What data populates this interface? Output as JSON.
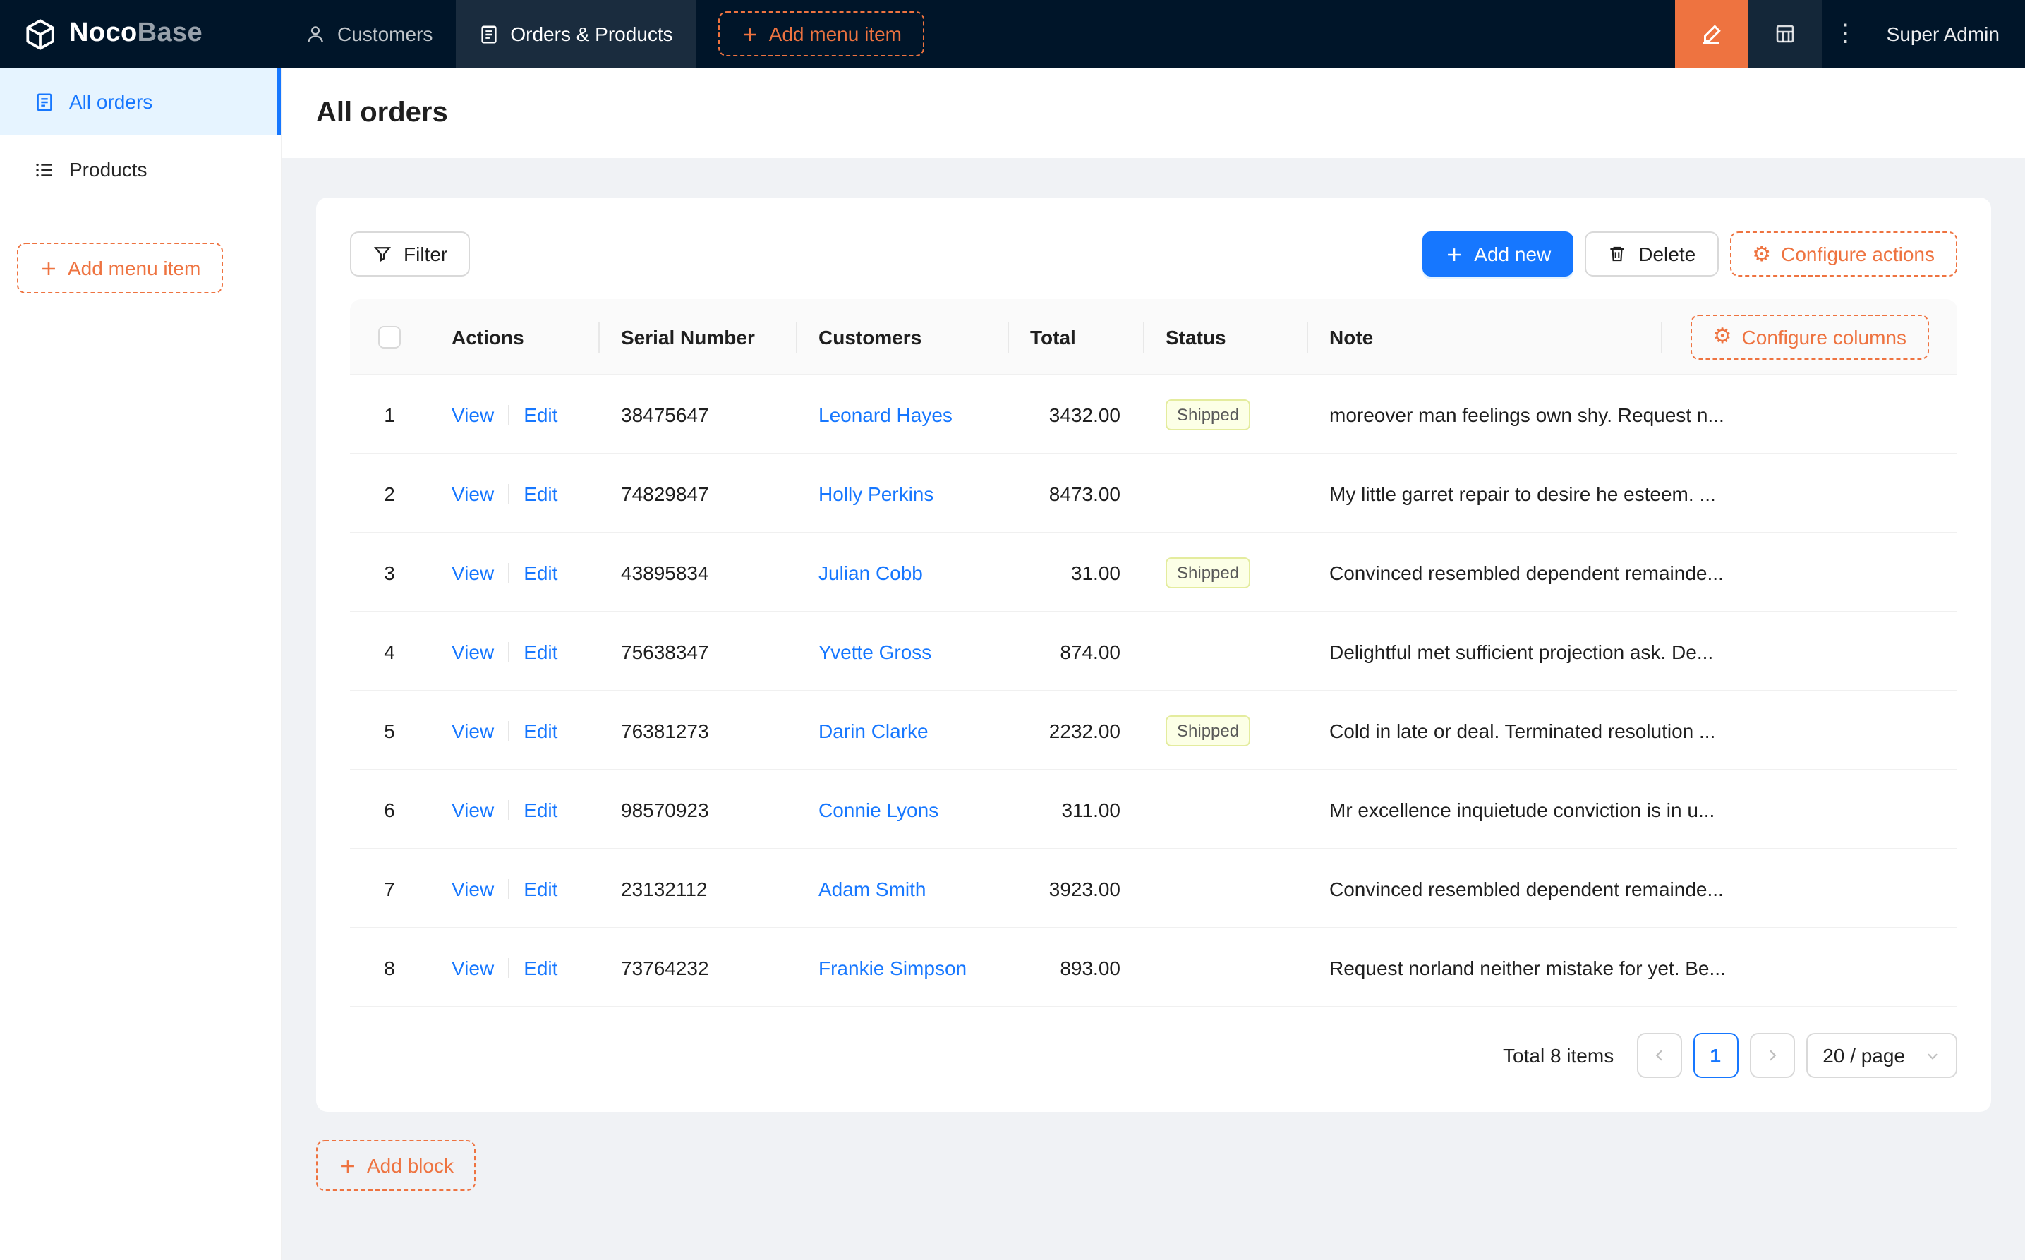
{
  "colors": {
    "header_bg": "#001529",
    "accent_orange": "#ee7340",
    "primary_blue": "#1677ff",
    "sidebar_active_bg": "#e6f4ff",
    "status_shipped_bg": "#fcffe6",
    "status_shipped_border": "#e4ec9e"
  },
  "header": {
    "brand_bold": "Noco",
    "brand_light": "Base",
    "nav": [
      {
        "label": "Customers"
      },
      {
        "label": "Orders & Products"
      }
    ],
    "add_menu_item": "Add menu item",
    "user": "Super Admin"
  },
  "sidebar": {
    "items": [
      {
        "label": "All orders"
      },
      {
        "label": "Products"
      }
    ],
    "add_menu_item": "Add menu item"
  },
  "page": {
    "title": "All orders"
  },
  "toolbar": {
    "filter": "Filter",
    "add_new": "Add new",
    "delete": "Delete",
    "configure_actions": "Configure actions"
  },
  "table": {
    "configure_columns": "Configure columns",
    "columns": {
      "actions": "Actions",
      "serial": "Serial Number",
      "customers": "Customers",
      "total": "Total",
      "status": "Status",
      "note": "Note"
    },
    "actions": {
      "view": "View",
      "edit": "Edit"
    },
    "rows": [
      {
        "index": "1",
        "serial": "38475647",
        "customer": "Leonard Hayes",
        "total": "3432.00",
        "status": "Shipped",
        "note": "moreover man feelings own shy. Request n..."
      },
      {
        "index": "2",
        "serial": "74829847",
        "customer": "Holly Perkins",
        "total": "8473.00",
        "status": "",
        "note": "My little garret repair to desire he esteem. ..."
      },
      {
        "index": "3",
        "serial": "43895834",
        "customer": "Julian Cobb",
        "total": "31.00",
        "status": "Shipped",
        "note": "Convinced resembled dependent remainde..."
      },
      {
        "index": "4",
        "serial": "75638347",
        "customer": "Yvette Gross",
        "total": "874.00",
        "status": "",
        "note": "Delightful met sufficient projection ask. De..."
      },
      {
        "index": "5",
        "serial": "76381273",
        "customer": "Darin Clarke",
        "total": "2232.00",
        "status": "Shipped",
        "note": "Cold in late or deal. Terminated resolution ..."
      },
      {
        "index": "6",
        "serial": "98570923",
        "customer": "Connie Lyons",
        "total": "311.00",
        "status": "",
        "note": "Mr excellence inquietude conviction is in u..."
      },
      {
        "index": "7",
        "serial": "23132112",
        "customer": "Adam Smith",
        "total": "3923.00",
        "status": "",
        "note": "Convinced resembled dependent remainde..."
      },
      {
        "index": "8",
        "serial": "73764232",
        "customer": "Frankie Simpson",
        "total": "893.00",
        "status": "",
        "note": "Request norland neither mistake for yet. Be..."
      }
    ]
  },
  "pagination": {
    "total": "Total 8 items",
    "page": "1",
    "page_size": "20 / page"
  },
  "footer": {
    "add_block": "Add block"
  }
}
